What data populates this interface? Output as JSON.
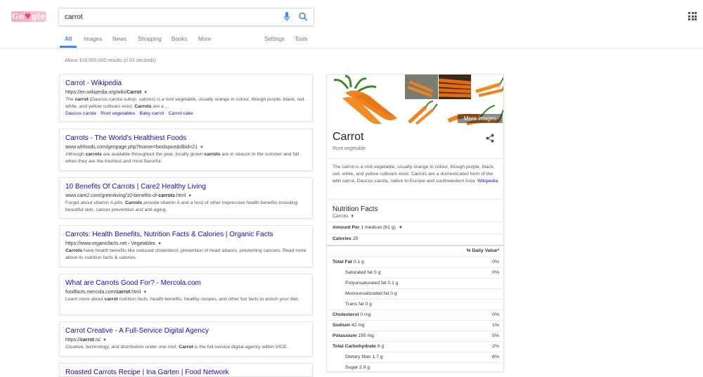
{
  "logo": {
    "left": "Go",
    "right": "gle"
  },
  "search": {
    "value": "carrot"
  },
  "tabs": [
    "All",
    "Images",
    "News",
    "Shopping",
    "Books",
    "More",
    "Settings",
    "Tools"
  ],
  "stats": "About 103,000,000 results (0.63 seconds)",
  "results": [
    {
      "title": "Carrot - Wikipedia",
      "url_pre": "https://en.wikipedia.org/wiki/",
      "url_bold": "Carrot",
      "snippet_html": "The <b>carrot</b> (Daucus carota subsp. sativus) is a root vegetable, usually orange in colour, though purple, black, red, white, and yellow cultivars exist. <b>Carrots</b> are a ...",
      "sitelinks": [
        "Daucus carota",
        "Root vegetables",
        "Baby carrot",
        "Carrot cake"
      ]
    },
    {
      "title": "Carrots - The World's Healthiest Foods",
      "url_pre": "www.whfoods.com/genpage.php?tname=foodspice&dbid=21",
      "url_bold": "",
      "snippet_html": "Although <b>carrots</b> are available throughout the year, locally grown <b>carrots</b> are in season in the summer and fall when they are the freshest and most flavorful.",
      "sitelinks": []
    },
    {
      "title": "10 Benefits Of Carrots | Care2 Healthy Living",
      "url_pre": "www.care2.com/greenliving/10-benefits-of-",
      "url_bold": "carrots",
      "url_post": ".html",
      "snippet_html": "Forget about vitamin A pills. <b>Carrots</b> provide vitamin A and a host of other impressive health benefits including beautiful skin, cancer prevention and anti-aging.",
      "sitelinks": []
    },
    {
      "title": "Carrots: Health Benefits, Nutrition Facts & Calories | Organic Facts",
      "url_pre": "https://www.organicfacts.net › Vegetables",
      "url_bold": "",
      "snippet_html": "<b>Carrots</b> have health benefits like reduced cholesterol, prevention of heart attacks, preventing cancers. Read more about its nutrition facts & calories.",
      "sitelinks": []
    },
    {
      "title": "What are Carrots Good For? - Mercola.com",
      "url_pre": "foodfacts.mercola.com/",
      "url_bold": "carrot",
      "url_post": ".html",
      "snippet_html": "Learn more about <b>carrot</b> nutrition facts, health benefits, healthy recipes, and other fun facts to enrich your diet.",
      "sitelinks": []
    },
    {
      "title": "Carrot Creative - A Full-Service Digital Agency",
      "url_pre": "https://",
      "url_bold": "carrot",
      "url_post": ".is/",
      "snippet_html": "Creative, technology, and distribution under one roof. <b>Carrot</b> is the full-service digital agency within VICE.",
      "sitelinks": []
    },
    {
      "title": "Roasted Carrots Recipe | Ina Garten | Food Network",
      "url_pre": "",
      "url_bold": "",
      "snippet_html": "",
      "sitelinks": []
    }
  ],
  "kp": {
    "title": "Carrot",
    "subtitle": "Root vegetable",
    "more_images": "More images",
    "description": "The carrot is a root vegetable, usually orange in colour, though purple, black, red, white, and yellow cultivars exist. Carrots are a domesticated form of the wild carrot, Daucus carota, native to Europe and southwestern Asia.",
    "desc_link": "Wikipedia",
    "nf_title": "Nutrition Facts",
    "nf_item": "Carrots",
    "amount_per_label": "Amount Per",
    "amount_per_value": "1 medium (61 g)",
    "calories_label": "Calories",
    "calories_value": "25",
    "dv_header": "% Daily Value*",
    "rows": [
      {
        "label": "Total Fat",
        "amount": "0.1 g",
        "dv": "0%",
        "bold": true,
        "indent": false
      },
      {
        "label": "Saturated fat",
        "amount": "0 g",
        "dv": "0%",
        "bold": false,
        "indent": true
      },
      {
        "label": "Polyunsaturated fat",
        "amount": "0.1 g",
        "dv": "",
        "bold": false,
        "indent": true
      },
      {
        "label": "Monounsaturated fat",
        "amount": "0 g",
        "dv": "",
        "bold": false,
        "indent": true
      },
      {
        "label": "Trans fat",
        "amount": "0 g",
        "dv": "",
        "bold": false,
        "indent": true
      },
      {
        "label": "Cholesterol",
        "amount": "0 mg",
        "dv": "0%",
        "bold": true,
        "indent": false
      },
      {
        "label": "Sodium",
        "amount": "42 mg",
        "dv": "1%",
        "bold": true,
        "indent": false
      },
      {
        "label": "Potassium",
        "amount": "195 mg",
        "dv": "5%",
        "bold": true,
        "indent": false
      },
      {
        "label": "Total Carbohydrate",
        "amount": "6 g",
        "dv": "2%",
        "bold": true,
        "indent": false
      },
      {
        "label": "Dietary fiber",
        "amount": "1.7 g",
        "dv": "6%",
        "bold": false,
        "indent": true
      },
      {
        "label": "Sugar",
        "amount": "2.9 g",
        "dv": "",
        "bold": false,
        "indent": true
      }
    ]
  },
  "colors": {
    "accent": "#4285f4",
    "link": "#1a0dab",
    "logo": "#f6a7c0"
  },
  "icons": {
    "mic": "mic-icon",
    "search": "search-icon",
    "apps": "apps-grid-icon",
    "share": "share-icon"
  }
}
